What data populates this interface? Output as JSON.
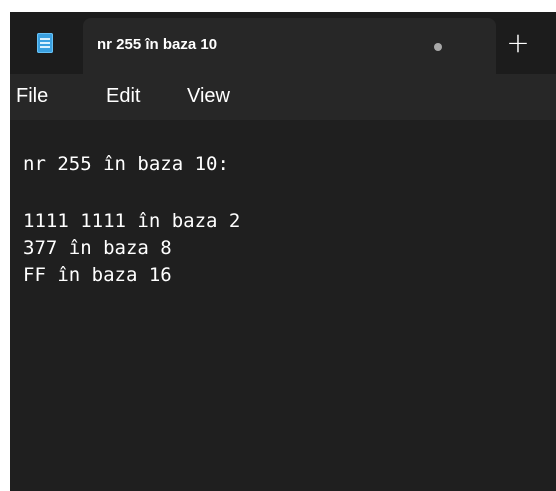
{
  "tab": {
    "title": "nr 255 în baza 10",
    "new_tab_symbol": "+",
    "app_icon": "notepad-icon",
    "unsaved_indicator": "dot"
  },
  "menu": {
    "items": [
      {
        "label": "File"
      },
      {
        "label": "Edit"
      },
      {
        "label": "View"
      }
    ]
  },
  "document": {
    "lines": [
      "nr 255 în baza 10:",
      "",
      "1111 1111 în baza 2",
      "377 în baza 8",
      "FF în baza 16"
    ]
  },
  "colors": {
    "titlebar": "#1c1c1c",
    "tab": "#272727",
    "editor": "#1f1f1f",
    "text": "#ffffff",
    "icon": "#3aa0e0"
  }
}
